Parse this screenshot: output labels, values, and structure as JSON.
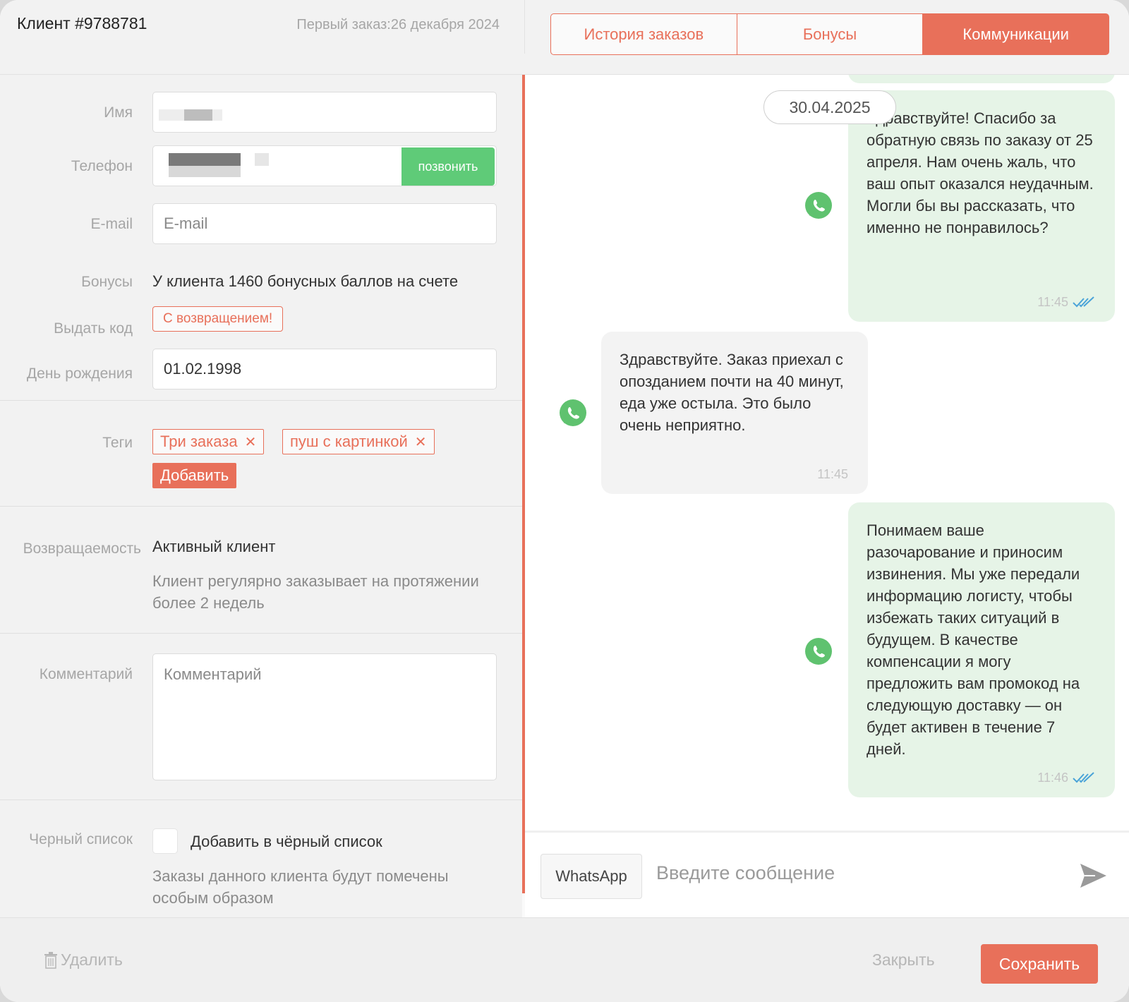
{
  "header": {
    "client_title": "Клиент #9788781",
    "first_order": "Первый заказ:26 декабря 2024"
  },
  "tabs": [
    {
      "label": "История заказов",
      "active": false
    },
    {
      "label": "Бонусы",
      "active": false
    },
    {
      "label": "Коммуникации",
      "active": true
    }
  ],
  "form": {
    "name": {
      "label": "Имя",
      "value": ""
    },
    "phone": {
      "label": "Телефон",
      "value": "",
      "call_label": "позвонить"
    },
    "email": {
      "label": "E-mail",
      "placeholder": "E-mail"
    },
    "bonuses": {
      "label": "Бонусы",
      "text": "У клиента 1460 бонусных баллов на счете"
    },
    "issue_code": {
      "label": "Выдать код",
      "code": "С возвращением!"
    },
    "birthday": {
      "label": "День рождения",
      "value": "01.02.1998"
    },
    "tags": {
      "label": "Теги",
      "items": [
        "Три заказа",
        "пуш с картинкой"
      ],
      "add_label": "Добавить"
    },
    "retention": {
      "label": "Возвращаемость",
      "status": "Активный клиент",
      "description": "Клиент регулярно заказывает на протяжении более 2 недель"
    },
    "comment": {
      "label": "Комментарий",
      "placeholder": "Комментарий"
    },
    "blacklist": {
      "label": "Черный список",
      "checkbox_label": "Добавить в чёрный список",
      "checked": false,
      "description": "Заказы данного клиента будут помечены особым образом"
    }
  },
  "chat": {
    "date_separator": "30.04.2025",
    "messages": [
      {
        "direction": "out",
        "text": "Здравствуйте! Спасибо за обратную связь по заказу от 25 апреля. Нам очень жаль, что ваш опыт оказался неудачным. Могли бы вы рассказать, что именно не понравилось?",
        "time": "11:45",
        "read": true,
        "channel_icon": "whatsapp-icon"
      },
      {
        "direction": "in",
        "text": "Здравствуйте. Заказ приехал с опозданием почти на 40 минут, еда уже остыла. Это было очень неприятно.",
        "time": "11:45",
        "channel_icon": "whatsapp-icon"
      },
      {
        "direction": "out",
        "text": "Понимаем ваше разочарование и приносим извинения. Мы уже передали информацию логисту, чтобы избежать таких ситуаций в будущем. В качестве компенсации я могу предложить вам промокод на следующую доставку — он будет активен в течение 7 дней.",
        "time": "11:46",
        "read": true,
        "channel_icon": "whatsapp-icon"
      }
    ],
    "composer": {
      "channel": "WhatsApp",
      "placeholder": "Введите сообщение"
    }
  },
  "footer": {
    "delete_label": "Удалить",
    "close_label": "Закрыть",
    "save_label": "Сохранить"
  },
  "colors": {
    "accent": "#e8705a",
    "call_green": "#5fcb78",
    "whatsapp_green": "#5fc26f",
    "outgoing_bubble": "#e6f4e7",
    "incoming_bubble": "#f3f3f3",
    "read_check": "#4aa3d8"
  }
}
